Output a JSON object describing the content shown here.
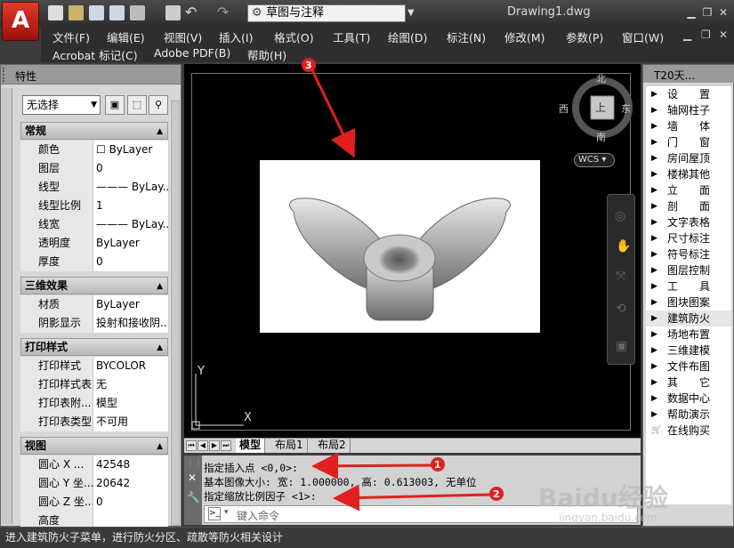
{
  "app": {
    "window_title": "Drawing1.dwg",
    "logo_letter": "A"
  },
  "workspace": {
    "selected": "草图与注释"
  },
  "menus": {
    "row1": [
      "文件(F)",
      "编辑(E)",
      "视图(V)",
      "插入(I)",
      "格式(O)",
      "工具(T)",
      "绘图(D)",
      "标注(N)",
      "修改(M)",
      "参数(P)",
      "窗口(W)"
    ],
    "row2": [
      "Acrobat 标记(C)",
      "Adobe PDF(B)",
      "帮助(H)"
    ]
  },
  "properties": {
    "title": "特性",
    "selection": "无选择",
    "sections": [
      {
        "name": "常规",
        "rows": [
          {
            "k": "颜色",
            "v": "☐ ByLayer"
          },
          {
            "k": "图层",
            "v": "0"
          },
          {
            "k": "线型",
            "v": "——— ByLay..."
          },
          {
            "k": "线型比例",
            "v": "1"
          },
          {
            "k": "线宽",
            "v": "——— ByLay..."
          },
          {
            "k": "透明度",
            "v": "ByLayer"
          },
          {
            "k": "厚度",
            "v": "0"
          }
        ]
      },
      {
        "name": "三维效果",
        "rows": [
          {
            "k": "材质",
            "v": "ByLayer"
          },
          {
            "k": "阴影显示",
            "v": "投射和接收阴..."
          }
        ]
      },
      {
        "name": "打印样式",
        "rows": [
          {
            "k": "打印样式",
            "v": "BYCOLOR"
          },
          {
            "k": "打印样式表",
            "v": "无"
          },
          {
            "k": "打印表附...",
            "v": "模型"
          },
          {
            "k": "打印表类型",
            "v": "不可用"
          }
        ]
      },
      {
        "name": "视图",
        "rows": [
          {
            "k": "圆心 X ...",
            "v": "42548"
          },
          {
            "k": "圆心 Y 坐...",
            "v": "20642"
          },
          {
            "k": "圆心 Z 坐...",
            "v": "0"
          },
          {
            "k": "高度",
            "v": ""
          }
        ]
      }
    ]
  },
  "viewcube": {
    "north": "北",
    "south": "南",
    "east": "东",
    "west": "西",
    "top": "上",
    "ucs": "WCS"
  },
  "ucs_icon": {
    "x_label": "X",
    "y_label": "Y"
  },
  "layout_tabs": [
    "模型",
    "布局1",
    "布局2"
  ],
  "command": {
    "history": [
      "指定插入点 <0,0>:",
      "基本图像大小: 宽: 1.000000, 高: 0.613003, 无单位",
      "指定缩放比例因子 <1>:"
    ],
    "placeholder": "键入命令"
  },
  "t20": {
    "title": "T20天...",
    "items": [
      "设　　置",
      "轴网柱子",
      "墙　　体",
      "门　　窗",
      "房间屋顶",
      "楼梯其他",
      "立　　面",
      "剖　　面",
      "文字表格",
      "尺寸标注",
      "符号标注",
      "图层控制",
      "工　　具",
      "图块图案",
      "建筑防火",
      "场地布置",
      "三维建模",
      "文件布图",
      "其　　它",
      "数据中心",
      "帮助演示",
      "在线购买"
    ],
    "highlighted_index": 14
  },
  "status": {
    "text": "进入建筑防火子菜单，进行防火分区、疏散等防火相关设计"
  },
  "annotations": {
    "badges": [
      "1",
      "2",
      "3"
    ],
    "color": "#e02020"
  },
  "watermark": {
    "text": "Baidu经验",
    "sub": "jingyan.baidu.com"
  }
}
